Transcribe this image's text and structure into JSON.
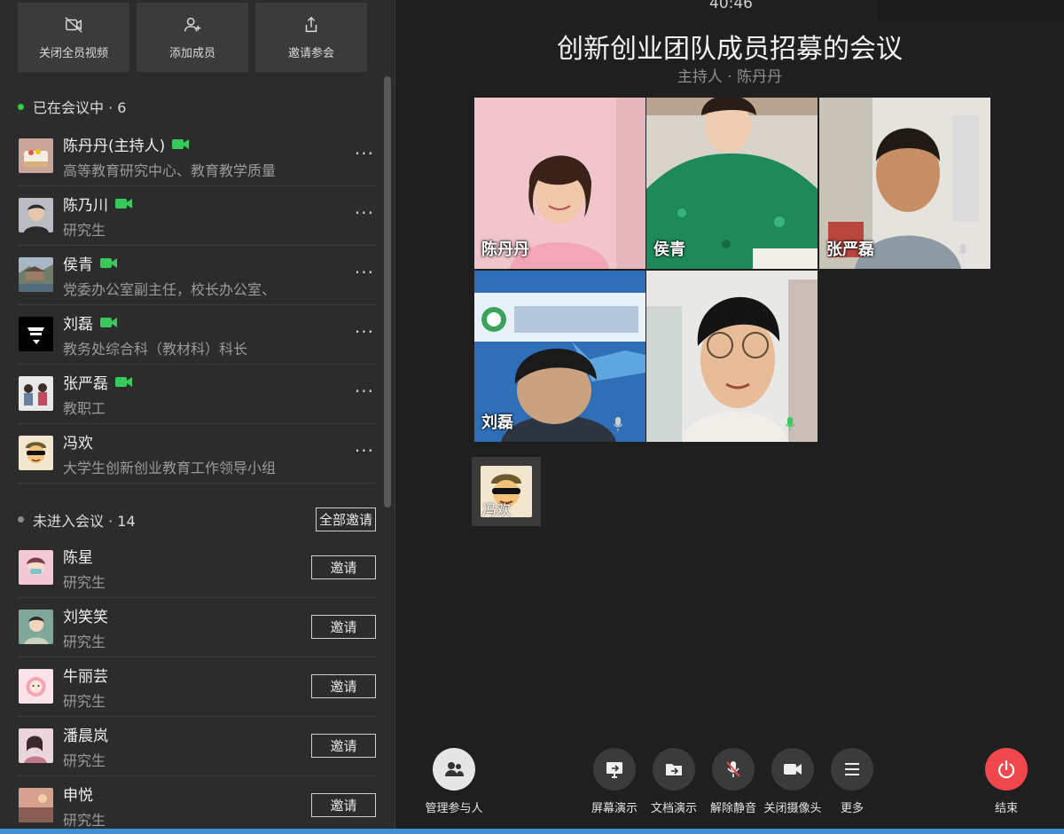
{
  "sidebar": {
    "top_buttons": [
      {
        "label": "关闭全员视频",
        "icon": "video-off-icon"
      },
      {
        "label": "添加成员",
        "icon": "add-user-icon"
      },
      {
        "label": "邀请参会",
        "icon": "share-icon"
      }
    ],
    "in_meeting": {
      "title": "已在会议中 · 6",
      "status_color": "#2ecc40",
      "members": [
        {
          "name": "陈丹丹(主持人)",
          "subtitle": "高等教育研究中心、教育教学质量",
          "video_on": true
        },
        {
          "name": "陈乃川",
          "subtitle": "研究生",
          "video_on": true
        },
        {
          "name": "侯青",
          "subtitle": "党委办公室副主任，校长办公室、",
          "video_on": true
        },
        {
          "name": "刘磊",
          "subtitle": "教务处综合科（教材科）科长",
          "video_on": true
        },
        {
          "name": "张严磊",
          "subtitle": "教职工",
          "video_on": true
        },
        {
          "name": "冯欢",
          "subtitle": "大学生创新创业教育工作领导小组",
          "video_on": false
        }
      ]
    },
    "not_joined": {
      "title": "未进入会议 · 14",
      "status_color": "#8a8a8a",
      "invite_all_label": "全部邀请",
      "invite_label": "邀请",
      "members": [
        {
          "name": "陈星",
          "subtitle": "研究生"
        },
        {
          "name": "刘笑笑",
          "subtitle": "研究生"
        },
        {
          "name": "牛丽芸",
          "subtitle": "研究生"
        },
        {
          "name": "潘晨岚",
          "subtitle": "研究生"
        },
        {
          "name": "申悦",
          "subtitle": "研究生"
        }
      ]
    }
  },
  "meeting": {
    "timer": "40:46",
    "title": "创新创业团队成员招募的会议",
    "host_line": "主持人 · 陈丹丹",
    "videos": [
      {
        "name": "陈丹丹"
      },
      {
        "name": "侯青"
      },
      {
        "name": "张严磊"
      },
      {
        "name": "刘磊"
      },
      {
        "name": ""
      }
    ],
    "audio_only_tile": {
      "name": "冯欢"
    }
  },
  "toolbar": {
    "manage": "管理参与人",
    "screen_share": "屏幕演示",
    "doc_share": "文档演示",
    "unmute": "解除静音",
    "camera_off": "关闭摄像头",
    "more": "更多",
    "end": "结束",
    "end_color": "#f0474c"
  }
}
